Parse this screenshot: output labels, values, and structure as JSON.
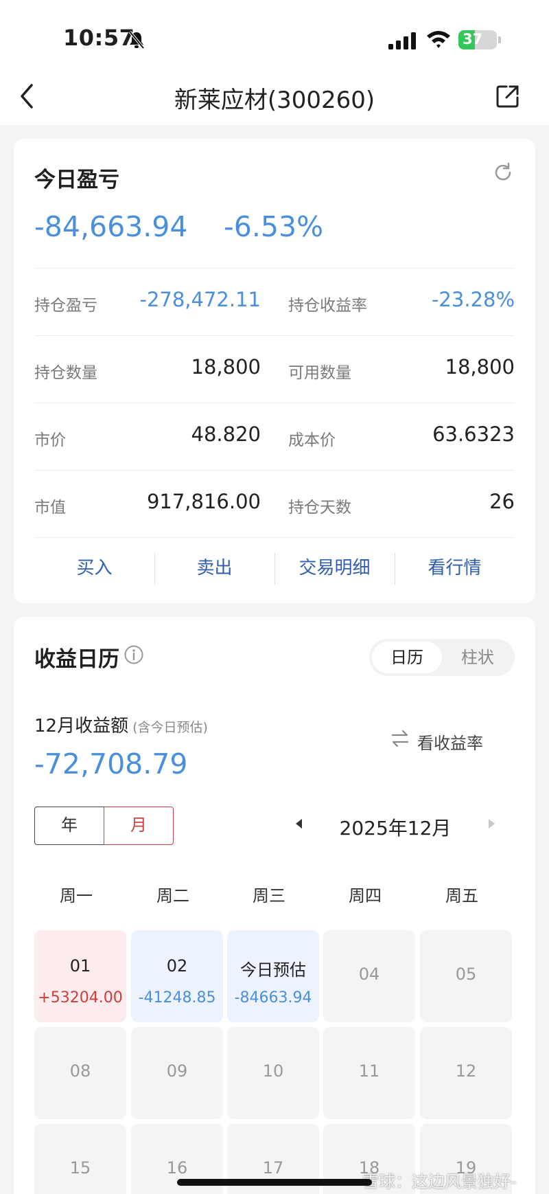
{
  "status": {
    "time": "10:57",
    "battery": "37"
  },
  "nav": {
    "title": "新莱应材(300260)"
  },
  "today": {
    "title": "今日盈亏",
    "amount": "-84,663.94",
    "percent": "-6.53%"
  },
  "stats": [
    {
      "l1": "持仓盈亏",
      "v1": "-278,472.11",
      "l2": "持仓收益率",
      "v2": "-23.28%"
    },
    {
      "l1": "持仓数量",
      "v1": "18,800",
      "l2": "可用数量",
      "v2": "18,800"
    },
    {
      "l1": "市价",
      "v1": "48.820",
      "l2": "成本价",
      "v2": "63.6323"
    },
    {
      "l1": "市值",
      "v1": "917,816.00",
      "l2": "持仓天数",
      "v2": "26"
    }
  ],
  "actions": [
    "买入",
    "卖出",
    "交易明细",
    "看行情"
  ],
  "calendar": {
    "title": "收益日历",
    "seg_on": "日历",
    "seg_off": "柱状",
    "month_label": "12月收益额",
    "month_note": "(含今日预估)",
    "switch_rate": "看收益率",
    "month_amount": "-72,708.79",
    "year_btn": "年",
    "month_btn": "月",
    "current_month": "2025年12月",
    "weekdays": [
      "周一",
      "周二",
      "周三",
      "周四",
      "周五"
    ],
    "days": [
      {
        "d": "01",
        "p": "+53204.00",
        "type": "pos"
      },
      {
        "d": "02",
        "p": "-41248.85",
        "type": "neg"
      },
      {
        "d": "今日预估",
        "p": "-84663.94",
        "type": "neg"
      },
      {
        "d": "04",
        "p": "",
        "type": "plain"
      },
      {
        "d": "05",
        "p": "",
        "type": "plain"
      },
      {
        "d": "08",
        "p": "",
        "type": "plain"
      },
      {
        "d": "09",
        "p": "",
        "type": "plain"
      },
      {
        "d": "10",
        "p": "",
        "type": "plain"
      },
      {
        "d": "11",
        "p": "",
        "type": "plain"
      },
      {
        "d": "12",
        "p": "",
        "type": "plain"
      },
      {
        "d": "15",
        "p": "",
        "type": "plain"
      },
      {
        "d": "16",
        "p": "",
        "type": "plain"
      },
      {
        "d": "17",
        "p": "",
        "type": "plain"
      },
      {
        "d": "18",
        "p": "",
        "type": "plain"
      },
      {
        "d": "19",
        "p": "",
        "type": "plain"
      }
    ]
  },
  "watermark": "雪球：这边风景独好-",
  "colors": {
    "loss": "#4a8fdb",
    "gain": "#cf3c3c",
    "accent": "#2f5db0"
  }
}
